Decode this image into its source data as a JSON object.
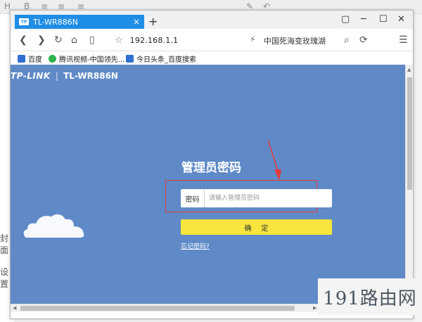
{
  "background_app": {
    "left_texts": [
      "封面",
      "设置"
    ]
  },
  "browser": {
    "tab": {
      "favicon_text": "TP",
      "title": "TL-WR886N",
      "close": "×"
    },
    "new_tab": "+",
    "window_controls": [
      "▢",
      "─",
      "☐",
      "✕"
    ],
    "nav": {
      "back": "❮",
      "forward": "❯",
      "reload": "↻",
      "home": "⌂",
      "reader": "▯"
    },
    "address": {
      "url": "192.168.1.1",
      "star": "☆"
    },
    "forward_arrow": "⚡",
    "search_text": "中国死海变玫瑰湖",
    "search_icon": "⌕",
    "toolbar_icons": [
      "⟳",
      "☰"
    ],
    "bookmarks": [
      {
        "label": "百度",
        "color": "#2f6fd1"
      },
      {
        "label": "腾讯视频-中国领先...",
        "color": "#2fb34d"
      },
      {
        "label": "今日头条_百度搜索",
        "color": "#2f6fd1"
      }
    ]
  },
  "router_page": {
    "brand_logo": "TP-LINK",
    "brand_separator": "|",
    "model": "TL-WR886N",
    "login_title": "管理员密码",
    "password_label": "密码",
    "password_placeholder": "请输入管理员密码",
    "password_value": "",
    "confirm_button": "确定",
    "forgot_link": "忘记密码?",
    "background_color": "#5f8ac7",
    "button_color": "#f7e43d",
    "highlight_color": "#e23c3c"
  },
  "watermark": "191路由网"
}
